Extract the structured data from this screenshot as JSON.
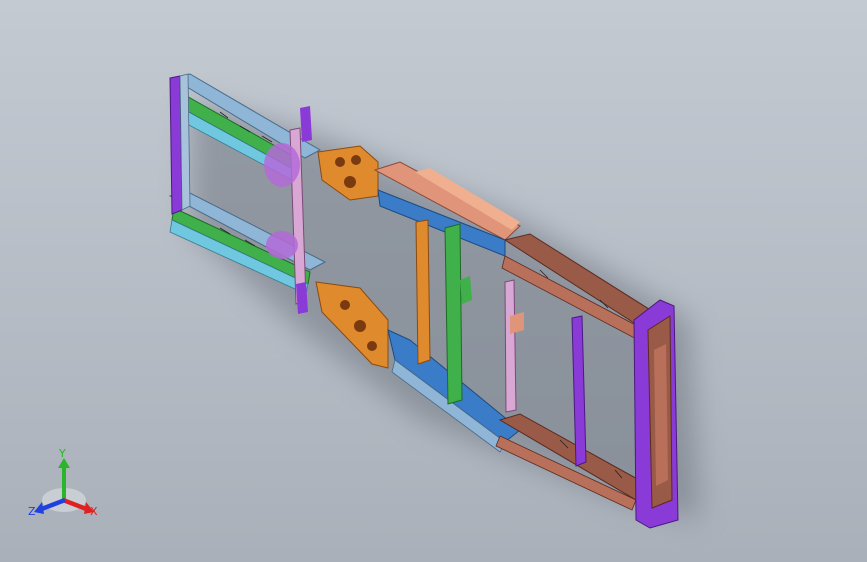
{
  "viewport": {
    "background_top": "#c4cad2",
    "background_bottom": "#a9b0b9"
  },
  "model": {
    "colors": {
      "rail_green": "#3fb04a",
      "rail_lightblue": "#8fb6d6",
      "member_purple": "#8a3ad6",
      "bracket_orange": "#e08a2e",
      "frame_brown": "#9a5a48",
      "crossmember_blue": "#3a7cc8",
      "salmon": "#e0957a",
      "shadow": "#6d7480"
    }
  },
  "triad": {
    "y_label": "Y",
    "x_label": "X",
    "z_label": "Z",
    "y_color": "#2bb52b",
    "x_color": "#e02020",
    "z_color": "#2040e0"
  }
}
